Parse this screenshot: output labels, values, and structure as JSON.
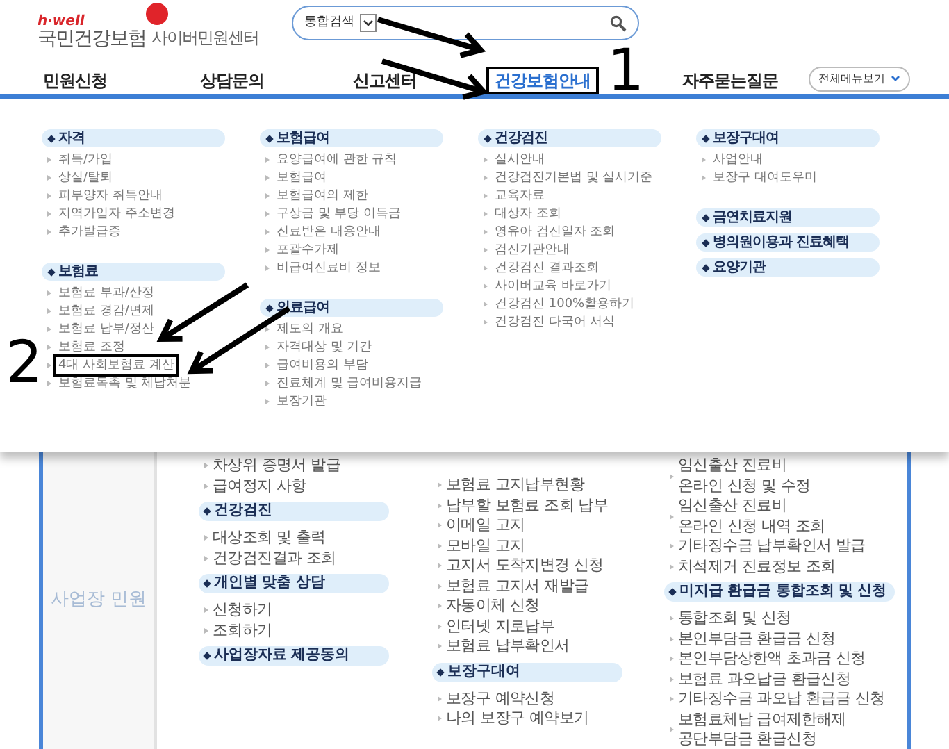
{
  "header": {
    "logo_tag": "h·well",
    "logo_name": "국민건강보험",
    "site_title": "사이버민원센터",
    "search": {
      "scope": "통합검색"
    }
  },
  "nav": [
    {
      "label": "민원신청",
      "selected": false,
      "highlighted": false
    },
    {
      "label": "상담문의",
      "selected": false,
      "highlighted": false
    },
    {
      "label": "신고센터",
      "selected": false,
      "highlighted": false
    },
    {
      "label": "건강보험안내",
      "selected": true,
      "highlighted": true
    },
    {
      "label": "자주묻는질문",
      "selected": false,
      "highlighted": false
    }
  ],
  "all_menu_button": "전체메뉴보기",
  "mega_menu": [
    [
      {
        "title": "자격",
        "items": [
          {
            "label": "취득/가입",
            "highlighted": false
          },
          {
            "label": "상실/탈퇴",
            "highlighted": false
          },
          {
            "label": "피부양자 취득안내",
            "highlighted": false
          },
          {
            "label": "지역가입자 주소변경",
            "highlighted": false
          },
          {
            "label": "추가발급증",
            "highlighted": false
          }
        ]
      },
      {
        "title": "보험료",
        "items": [
          {
            "label": "보험료 부과/산정",
            "highlighted": false
          },
          {
            "label": "보험료 경감/면제",
            "highlighted": false
          },
          {
            "label": "보험료 납부/정산",
            "highlighted": false
          },
          {
            "label": "보험료 조정",
            "highlighted": false
          },
          {
            "label": "4대 사회보험료 계산",
            "highlighted": true
          },
          {
            "label": "보험료독촉 및 체납처분",
            "highlighted": false
          }
        ]
      }
    ],
    [
      {
        "title": "보험급여",
        "items": [
          {
            "label": "요양급여에 관한 규칙",
            "highlighted": false
          },
          {
            "label": "보험급여",
            "highlighted": false
          },
          {
            "label": "보험급여의 제한",
            "highlighted": false
          },
          {
            "label": "구상금 및 부당 이득금",
            "highlighted": false
          },
          {
            "label": "진료받은 내용안내",
            "highlighted": false
          },
          {
            "label": "포괄수가제",
            "highlighted": false
          },
          {
            "label": "비급여진료비 정보",
            "highlighted": false
          }
        ]
      },
      {
        "title": "의료급여",
        "items": [
          {
            "label": "제도의 개요",
            "highlighted": false
          },
          {
            "label": "자격대상 및 기간",
            "highlighted": false
          },
          {
            "label": "급여비용의 부담",
            "highlighted": false
          },
          {
            "label": "진료체계 및 급여비용지급",
            "highlighted": false
          },
          {
            "label": "보장기관",
            "highlighted": false
          }
        ]
      }
    ],
    [
      {
        "title": "건강검진",
        "items": [
          {
            "label": "실시안내",
            "highlighted": false
          },
          {
            "label": "건강검진기본법 및 실시기준",
            "highlighted": false
          },
          {
            "label": "교육자료",
            "highlighted": false
          },
          {
            "label": "대상자 조회",
            "highlighted": false
          },
          {
            "label": "영유아 검진일자 조회",
            "highlighted": false
          },
          {
            "label": "검진기관안내",
            "highlighted": false
          },
          {
            "label": "건강검진 결과조회",
            "highlighted": false
          },
          {
            "label": "사이버교육 바로가기",
            "highlighted": false
          },
          {
            "label": "건강검진 100%활용하기",
            "highlighted": false
          },
          {
            "label": "건강검진 다국어 서식",
            "highlighted": false
          }
        ]
      }
    ],
    [
      {
        "title": "보장구대여",
        "items": [
          {
            "label": "사업안내",
            "highlighted": false
          },
          {
            "label": "보장구 대여도우미",
            "highlighted": false
          }
        ]
      },
      {
        "title": "금연치료지원"
      },
      {
        "title": "병의원이용과 진료혜택"
      },
      {
        "title": "요양기관"
      }
    ]
  ],
  "side_label": "사업장 민원",
  "content_columns": [
    [
      {
        "kind": "link",
        "label": "차상위 증명서 발급"
      },
      {
        "kind": "link",
        "label": "급여정지 사항"
      },
      {
        "kind": "heading",
        "label": "건강검진"
      },
      {
        "kind": "link",
        "label": "대상조회 및 출력"
      },
      {
        "kind": "link",
        "label": "건강검진결과 조회"
      },
      {
        "kind": "heading",
        "label": "개인별 맞춤 상담"
      },
      {
        "kind": "link",
        "label": "신청하기"
      },
      {
        "kind": "link",
        "label": "조회하기"
      },
      {
        "kind": "heading",
        "label": "사업장자료 제공동의"
      }
    ],
    [
      {
        "kind": "link",
        "label": "보험료 고지납부현황"
      },
      {
        "kind": "link",
        "label": "납부할 보험료 조회 납부"
      },
      {
        "kind": "link",
        "label": "이메일 고지"
      },
      {
        "kind": "link",
        "label": "모바일 고지"
      },
      {
        "kind": "link",
        "label": "고지서 도착지변경 신청"
      },
      {
        "kind": "link",
        "label": "보험료 고지서 재발급"
      },
      {
        "kind": "link",
        "label": "자동이체 신청"
      },
      {
        "kind": "link",
        "label": "인터넷 지로납부"
      },
      {
        "kind": "link",
        "label": "보험료 납부확인서"
      },
      {
        "kind": "heading",
        "label": "보장구대여"
      },
      {
        "kind": "link",
        "label": "보장구 예약신청"
      },
      {
        "kind": "link",
        "label": "나의 보장구 예약보기"
      }
    ],
    [
      {
        "kind": "link",
        "label": "임신출산 진료비\n온라인 신청 및 수정"
      },
      {
        "kind": "link",
        "label": "임신출산 진료비\n온라인 신청 내역 조회"
      },
      {
        "kind": "link",
        "label": "기타징수금 납부확인서 발급"
      },
      {
        "kind": "link",
        "label": "치석제거 진료정보 조회"
      },
      {
        "kind": "heading",
        "label": "미지급 환급금 통합조회 및 신청"
      },
      {
        "kind": "link",
        "label": "통합조회 및 신청"
      },
      {
        "kind": "link",
        "label": "본인부담금 환급금 신청"
      },
      {
        "kind": "link",
        "label": "본인부담상한액 초과금 신청"
      },
      {
        "kind": "link",
        "label": "보험료 과오납금 환급신청"
      },
      {
        "kind": "link",
        "label": "기타징수금 과오납 환급금 신청"
      },
      {
        "kind": "link",
        "label": "보험료체납 급여제한해제\n공단부담금 환급신청"
      }
    ]
  ],
  "annotations": [
    {
      "label": "1"
    },
    {
      "label": "2"
    }
  ]
}
